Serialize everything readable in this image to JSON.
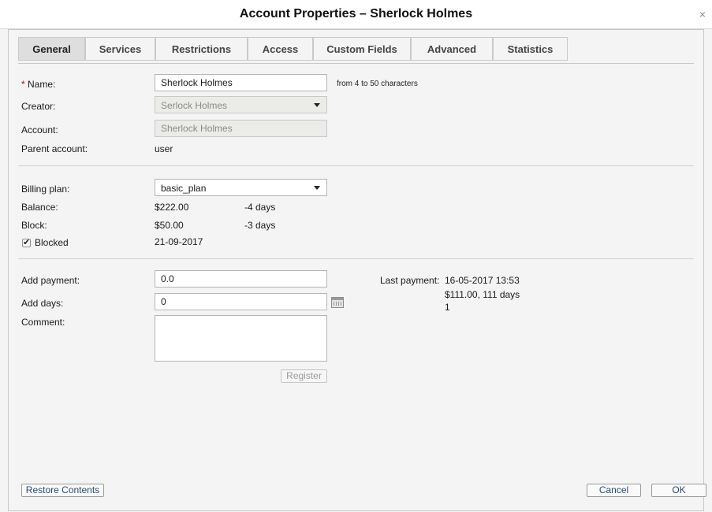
{
  "window": {
    "title": "Account Properties – Sherlock Holmes",
    "close_symbol": "×"
  },
  "tabs": [
    {
      "label": "General",
      "active": true
    },
    {
      "label": "Services"
    },
    {
      "label": "Restrictions"
    },
    {
      "label": "Access"
    },
    {
      "label": "Custom Fields"
    },
    {
      "label": "Advanced"
    },
    {
      "label": "Statistics"
    }
  ],
  "general": {
    "name": {
      "required_mark": "*",
      "label": "Name:",
      "value": "Sherlock Holmes",
      "hint": "from 4 to 50 characters"
    },
    "creator": {
      "label": "Creator:",
      "value": "Serlock Holmes"
    },
    "account": {
      "label": "Account:",
      "value": "Sherlock Holmes"
    },
    "parent_account": {
      "label": "Parent account:",
      "value": "user"
    }
  },
  "billing": {
    "plan": {
      "label": "Billing plan:",
      "value": "basic_plan"
    },
    "balance": {
      "label": "Balance:",
      "amount": "$222.00",
      "days": "-4 days"
    },
    "block": {
      "label": "Block:",
      "amount": "$50.00",
      "days": "-3 days"
    },
    "blocked": {
      "label": "Blocked",
      "checked": true,
      "date": "21-09-2017"
    }
  },
  "payment": {
    "add_payment": {
      "label": "Add payment:",
      "value": "0.0"
    },
    "add_days": {
      "label": "Add days:",
      "value": "0"
    },
    "comment": {
      "label": "Comment:",
      "value": ""
    },
    "register_label": "Register",
    "last_payment": {
      "label": "Last payment:",
      "datetime": "16-05-2017 13:53",
      "amount_days": "$111.00, 111 days",
      "extra": "1"
    }
  },
  "footer": {
    "restore_label": "Restore Contents",
    "cancel_label": "Cancel",
    "ok_label": "OK"
  },
  "colors": {
    "required": "#cc0000",
    "link_button_text": "#2a4a7a",
    "active_tab": "#dedede"
  }
}
